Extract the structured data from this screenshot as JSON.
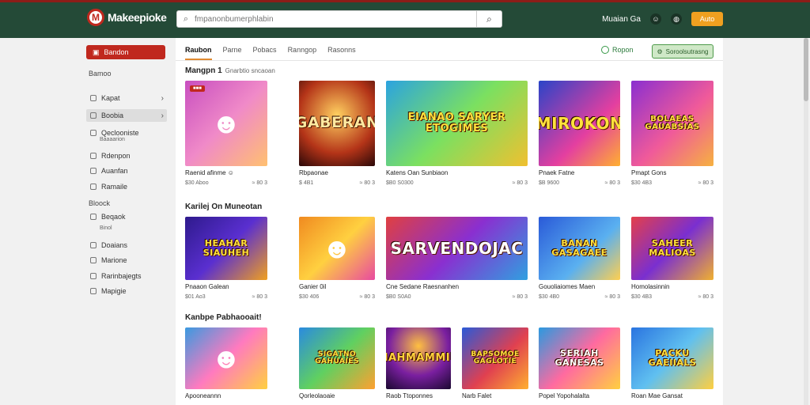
{
  "header": {
    "logo_letter": "M",
    "logo_text": "Makeepioke",
    "search_placeholder": "fmpanonbumerphlabin",
    "user_label": "Muaian Ga",
    "icons": [
      "user-icon",
      "globe-icon",
      "cart-icon"
    ],
    "cart_label": "Auto"
  },
  "sidebar": {
    "primary_button": "Bandon",
    "section1": "Bamoo",
    "items": [
      {
        "label": "Kapat",
        "sub": "",
        "chevron": "›"
      },
      {
        "label": "Boobia",
        "sub": "",
        "chevron": "›"
      },
      {
        "label": "Qeclooniste",
        "sub": "Baaaarion",
        "chevron": ""
      },
      {
        "label": "Rdenpon",
        "sub": "",
        "chevron": ""
      },
      {
        "label": "Auanfan",
        "sub": "",
        "chevron": ""
      },
      {
        "label": "Ramaile",
        "sub": "",
        "chevron": ""
      }
    ],
    "section2": "Bloock",
    "items2": [
      {
        "label": "Beqaok",
        "sub": "Binol"
      },
      {
        "label": "Doaians"
      },
      {
        "label": "Marione"
      },
      {
        "label": "Rarinbajegts"
      },
      {
        "label": "Mapigie"
      }
    ]
  },
  "tabs": [
    {
      "label": "Raubon",
      "active": true
    },
    {
      "label": "Parne",
      "active": false
    },
    {
      "label": "Pobacs",
      "active": false
    },
    {
      "label": "Ranngop",
      "active": false
    },
    {
      "label": "Rasonns",
      "active": false
    }
  ],
  "toggle_label": "Ropon",
  "green_button": "Soroolsutrasng",
  "sections": [
    {
      "title": "Mangpn 1",
      "subtitle": "Gnarbtio sncaoan",
      "cards": [
        {
          "name": "Raenid afinme ☺",
          "price": "$30 Aboo",
          "meta": "≈ 80 3",
          "art": "",
          "badge": "■■■",
          "bg": "linear-gradient(135deg,#c84fc0,#f08ac8 50%,#ffc070)",
          "color": "#fff"
        },
        {
          "name": "Rbpaonae",
          "price": "$ 4B1",
          "meta": "≈ 80 3",
          "art": "GABERAN",
          "badge": "",
          "bg": "radial-gradient(circle at 50% 40%,#ffd060,#b43418 60%,#2a0808)",
          "color": "#ffe9a0"
        },
        {
          "name": "Katens Oan Sunbiaon",
          "price": "$B0 S0300",
          "meta": "≈ 80 3",
          "art": "EIANAO SARYER ETOGIMES",
          "badge": "",
          "bg": "linear-gradient(135deg,#2ba3e0,#7be060 50%,#f0c030)",
          "color": "#ffe23c"
        },
        {
          "name": "Pnaek Fatne",
          "price": "$B 9600",
          "meta": "≈ 80 3",
          "art": "MIROKON",
          "badge": "",
          "bg": "linear-gradient(135deg,#2a44c8,#e43fa0 60%,#ffb030)",
          "color": "#ffe23c"
        },
        {
          "name": "Pmapt Gons",
          "price": "$30 4B3",
          "meta": "≈ 80 3",
          "art": "BOLAEAS GAUABSIAS",
          "badge": "",
          "bg": "linear-gradient(135deg,#8a2fd0,#f05a9a 55%,#f6b140)",
          "color": "#ffe23c"
        }
      ]
    },
    {
      "title": "Karilej On Muneotan",
      "subtitle": "",
      "cards": [
        {
          "name": "Pnaaon Galean",
          "price": "$01 Ao3",
          "meta": "≈ 80 3",
          "art": "HEAHAR SIAUHEH",
          "badge": "",
          "bg": "linear-gradient(135deg,#2e1a8c,#5a2fd0 50%,#f0a020)",
          "color": "#ffe23c"
        },
        {
          "name": "Ganier 0il",
          "price": "$30 406",
          "meta": "≈ 80 3",
          "art": "",
          "badge": "",
          "bg": "linear-gradient(135deg,#f08a20,#ffd040 50%,#e84aa0)",
          "color": "#fff"
        },
        {
          "name": "Cne Sedane Raesnanhen",
          "price": "$B0 S0A0",
          "meta": "≈ 80 3",
          "art": "SARVENDOJAC",
          "badge": "",
          "bg": "linear-gradient(135deg,#e04040,#8a2fd0 50%,#30a0e0)",
          "color": "#fff"
        },
        {
          "name": "Gouoliaiomes Maen",
          "price": "$30 4B0",
          "meta": "≈ 80 3",
          "art": "BANAN GASAGAEE",
          "badge": "",
          "bg": "linear-gradient(135deg,#2a5ad8,#5ab0f0 60%,#ffcf50)",
          "color": "#ffe23c"
        },
        {
          "name": "Homolasinnin",
          "price": "$30 4B3",
          "meta": "≈ 80 3",
          "art": "SAHEER MALIOAS",
          "badge": "",
          "bg": "linear-gradient(135deg,#e43f4a,#7a2fd0 50%,#f0b030)",
          "color": "#ffe23c"
        }
      ]
    },
    {
      "title": "Kanbpe Pabhaooait!",
      "subtitle": "",
      "cards": [
        {
          "name": "Apooneannn",
          "price": "",
          "meta": "",
          "art": "",
          "badge": "",
          "bg": "linear-gradient(135deg,#3a9ae0,#ff7abf 50%,#ffd040)",
          "color": "#fff"
        },
        {
          "name": "Qorleolaoaie",
          "price": "",
          "meta": "",
          "art": "SIGATNO GAHUAIES",
          "badge": "",
          "bg": "linear-gradient(135deg,#2a8ae0,#60d060 50%,#ffa030)",
          "color": "#ffe23c"
        },
        {
          "name": "Raob Ttoponnes",
          "price": "",
          "meta": "",
          "art": "MAHMAMMIN",
          "badge": "",
          "bg": "radial-gradient(circle at 50% 30%,#ffc040,#7a1fa0 55%,#1a0830)",
          "color": "#ffd23c"
        },
        {
          "name": "Narb Falet",
          "price": "",
          "meta": "",
          "art": "BAPSOMOE GAGLOTIE",
          "badge": "",
          "bg": "linear-gradient(135deg,#2a5ad8,#e04050 55%,#ffb030)",
          "color": "#ffe23c"
        },
        {
          "name": "Popel Yopohalalta",
          "price": "",
          "meta": "",
          "art": "SERIAH GANESAS",
          "badge": "",
          "bg": "linear-gradient(135deg,#2a9ae0,#ff6aa0 50%,#ffd040)",
          "color": "#fff"
        },
        {
          "name": "Roan Mae Gansat",
          "price": "",
          "meta": "",
          "art": "PACKU GAEIIALS",
          "badge": "",
          "bg": "linear-gradient(135deg,#2a74e0,#60c0f0 50%,#ffcf40)",
          "color": "#ffe23c"
        }
      ]
    }
  ]
}
